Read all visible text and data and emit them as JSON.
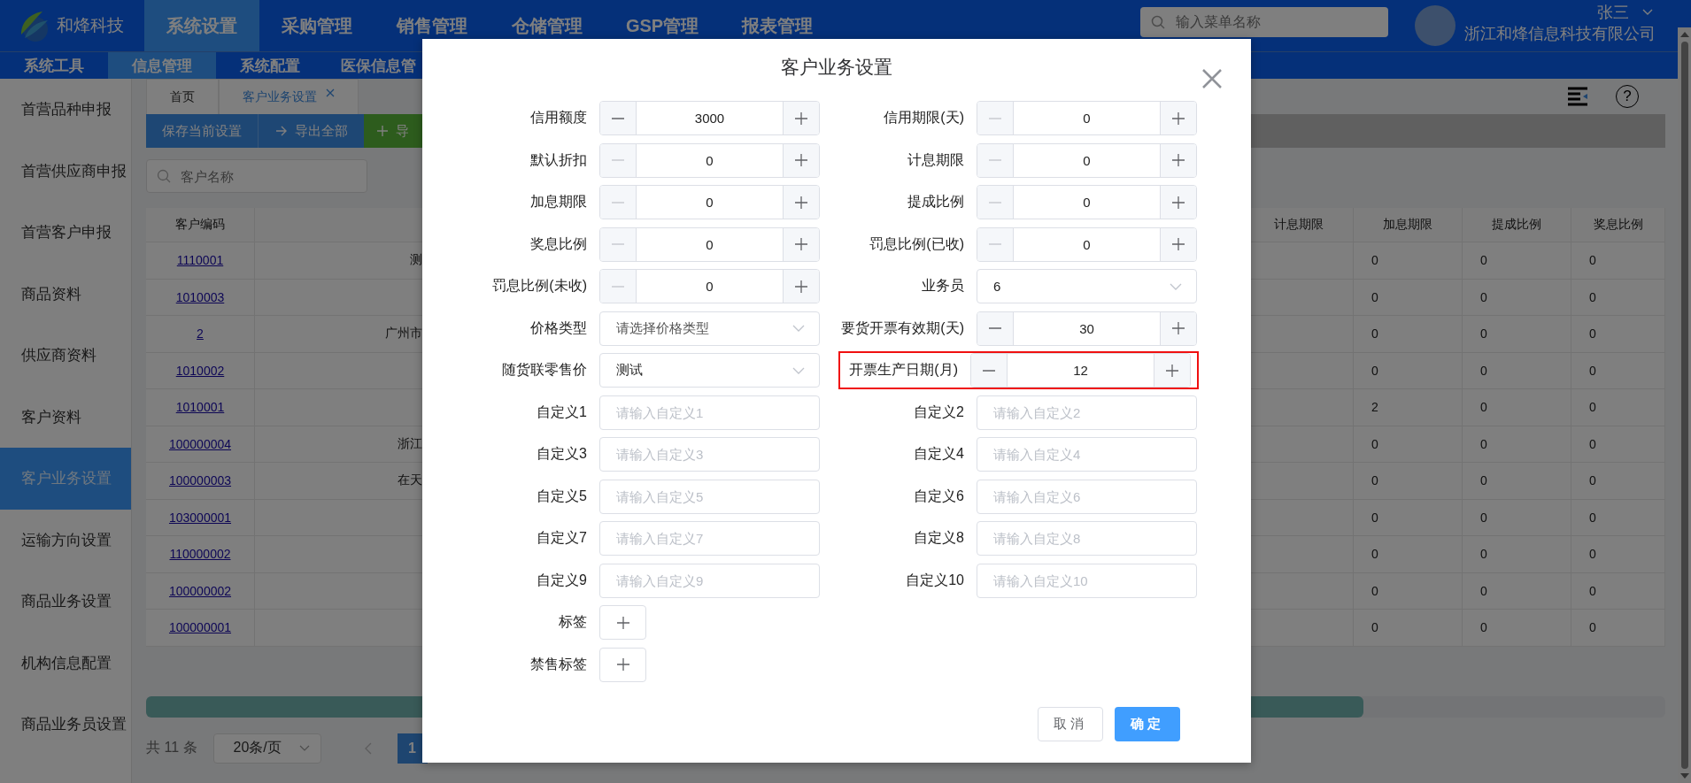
{
  "header": {
    "logo_text": "和烽科技",
    "search": {
      "placeholder": "输入菜单名称"
    },
    "help": {
      "label": "?"
    },
    "user": {
      "name": "张三",
      "company": "浙江和烽信息科技有限公司"
    },
    "nav": [
      {
        "label": "系统设置",
        "selected": true
      },
      {
        "label": "采购管理",
        "selected": false
      },
      {
        "label": "销售管理",
        "selected": false
      },
      {
        "label": "仓储管理",
        "selected": false
      },
      {
        "label": "GSP管理",
        "selected": false
      },
      {
        "label": "报表管理",
        "selected": false
      }
    ]
  },
  "subnav": [
    {
      "label": "系统工具",
      "selected": false
    },
    {
      "label": "信息管理",
      "selected": true
    },
    {
      "label": "系统配置",
      "selected": false
    },
    {
      "label": "医保信息管",
      "selected": false
    }
  ],
  "sidebar": [
    {
      "label": "首营品种申报",
      "selected": false
    },
    {
      "label": "首营供应商申报",
      "selected": false
    },
    {
      "label": "首营客户申报",
      "selected": false
    },
    {
      "label": "商品资料",
      "selected": false
    },
    {
      "label": "供应商资料",
      "selected": false
    },
    {
      "label": "客户资料",
      "selected": false
    },
    {
      "label": "客户业务设置",
      "selected": true
    },
    {
      "label": "运输方向设置",
      "selected": false
    },
    {
      "label": "商品业务设置",
      "selected": false
    },
    {
      "label": "机构信息配置",
      "selected": false
    },
    {
      "label": "商品业务员设置",
      "selected": false
    }
  ],
  "tabs": [
    {
      "label": "首页",
      "selected": false,
      "closable": false
    },
    {
      "label": "客户业务设置",
      "selected": true,
      "closable": true
    }
  ],
  "toolbar": [
    {
      "kind": "save",
      "label": "保存当前设置"
    },
    {
      "kind": "export",
      "label": "导出全部"
    },
    {
      "kind": "import",
      "label": "导"
    }
  ],
  "search": {
    "placeholder": "客户名称"
  },
  "table": {
    "columns": {
      "code": "客户编码",
      "interest_period": "计息期限",
      "surcharge_period": "加息期限",
      "commission_rate": "提成比例",
      "bonus_rate": "奖息比例"
    },
    "rows": [
      {
        "code": "1110001",
        "name": "测",
        "surcharge_period": "0",
        "commission_rate": "0",
        "bonus_rate": "0"
      },
      {
        "code": "1010003",
        "surcharge_period": "0",
        "commission_rate": "0",
        "bonus_rate": "0"
      },
      {
        "code": "2",
        "name": "广州市",
        "surcharge_period": "0",
        "commission_rate": "0",
        "bonus_rate": "0"
      },
      {
        "code": "1010002",
        "surcharge_period": "0",
        "commission_rate": "0",
        "bonus_rate": "0"
      },
      {
        "code": "1010001",
        "surcharge_period": "2",
        "commission_rate": "0",
        "bonus_rate": "0"
      },
      {
        "code": "100000004",
        "name": "浙江",
        "surcharge_period": "0",
        "commission_rate": "0",
        "bonus_rate": "0"
      },
      {
        "code": "100000003",
        "name": "在天",
        "surcharge_period": "0",
        "commission_rate": "0",
        "bonus_rate": "0"
      },
      {
        "code": "103000001",
        "surcharge_period": "0",
        "commission_rate": "0",
        "bonus_rate": "0"
      },
      {
        "code": "110000002",
        "surcharge_period": "0",
        "commission_rate": "0",
        "bonus_rate": "0"
      },
      {
        "code": "100000002",
        "surcharge_period": "0",
        "commission_rate": "0",
        "bonus_rate": "0"
      },
      {
        "code": "100000001",
        "surcharge_period": "0",
        "commission_rate": "0",
        "bonus_rate": "0"
      }
    ]
  },
  "pagination": {
    "total": "共 11 条",
    "page_size": "20条/页",
    "pages": [
      {
        "label": "1",
        "selected": true
      }
    ]
  },
  "dialog": {
    "title": "客户业务设置",
    "fields": [
      {
        "label": "信用额度",
        "kind": "number",
        "value": "3000",
        "minus_disabled": false,
        "highlighted": false
      },
      {
        "label": "信用期限(天)",
        "kind": "number",
        "value": "0",
        "minus_disabled": true,
        "highlighted": false
      },
      {
        "label": "默认折扣",
        "kind": "number",
        "value": "0",
        "minus_disabled": true,
        "highlighted": false
      },
      {
        "label": "计息期限",
        "kind": "number",
        "value": "0",
        "minus_disabled": true,
        "highlighted": false
      },
      {
        "label": "加息期限",
        "kind": "number",
        "value": "0",
        "minus_disabled": true,
        "highlighted": false
      },
      {
        "label": "提成比例",
        "kind": "number",
        "value": "0",
        "minus_disabled": true,
        "highlighted": false
      },
      {
        "label": "奖息比例",
        "kind": "number",
        "value": "0",
        "minus_disabled": true,
        "highlighted": false
      },
      {
        "label": "罚息比例(已收)",
        "kind": "number",
        "value": "0",
        "minus_disabled": true,
        "highlighted": false
      },
      {
        "label": "罚息比例(未收)",
        "kind": "number",
        "value": "0",
        "minus_disabled": true,
        "highlighted": false
      },
      {
        "label": "业务员",
        "kind": "select",
        "value": "6",
        "highlighted": false
      },
      {
        "label": "价格类型",
        "kind": "select",
        "placeholder": "请选择价格类型",
        "highlighted": false
      },
      {
        "label": "要货开票有效期(天)",
        "kind": "number",
        "value": "30",
        "minus_disabled": false,
        "highlighted": false
      },
      {
        "label": "随货联零售价",
        "kind": "select",
        "value": "测试",
        "highlighted": false
      },
      {
        "label": "开票生产日期(月)",
        "kind": "number",
        "value": "12",
        "minus_disabled": false,
        "highlighted": true
      },
      {
        "label": "自定义1",
        "kind": "text",
        "placeholder": "请输入自定义1",
        "highlighted": false
      },
      {
        "label": "自定义2",
        "kind": "text",
        "placeholder": "请输入自定义2",
        "highlighted": false
      },
      {
        "label": "自定义3",
        "kind": "text",
        "placeholder": "请输入自定义3",
        "highlighted": false
      },
      {
        "label": "自定义4",
        "kind": "text",
        "placeholder": "请输入自定义4",
        "highlighted": false
      },
      {
        "label": "自定义5",
        "kind": "text",
        "placeholder": "请输入自定义5",
        "highlighted": false
      },
      {
        "label": "自定义6",
        "kind": "text",
        "placeholder": "请输入自定义6",
        "highlighted": false
      },
      {
        "label": "自定义7",
        "kind": "text",
        "placeholder": "请输入自定义7",
        "highlighted": false
      },
      {
        "label": "自定义8",
        "kind": "text",
        "placeholder": "请输入自定义8",
        "highlighted": false
      },
      {
        "label": "自定义9",
        "kind": "text",
        "placeholder": "请输入自定义9",
        "highlighted": false
      },
      {
        "label": "自定义10",
        "kind": "text",
        "placeholder": "请输入自定义10",
        "highlighted": false
      }
    ],
    "tag_fields": [
      {
        "label": "标签"
      },
      {
        "label": "禁售标签"
      }
    ],
    "buttons": [
      {
        "kind": "cancel",
        "label": "取消"
      },
      {
        "kind": "confirm",
        "label": "确定"
      }
    ]
  }
}
